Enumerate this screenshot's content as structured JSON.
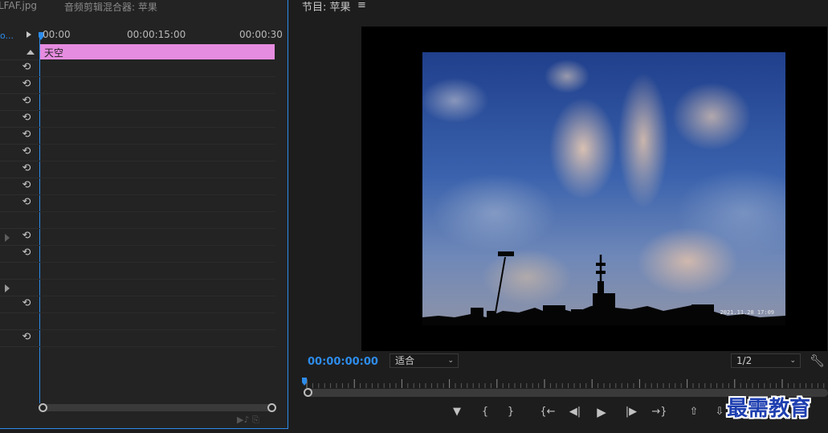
{
  "left_panel": {
    "tab_file": "LFAF.jpg",
    "tab_mixer": "音频剪辑混合器: 苹果",
    "header_label": "o...",
    "ruler": [
      "00:00",
      "00:00:15:00",
      "00:00:30"
    ],
    "clip_name": "天空",
    "reset_glyph": "⟲"
  },
  "program_monitor": {
    "title": "节目: 苹果",
    "menu_glyph": "≡",
    "timecode": "00:00:00:00",
    "fit_dropdown": "适合",
    "resolution_dropdown": "1/2",
    "video_timestamp": "2021.11.28 17:09",
    "chevron_glyph": "⌄",
    "transport": {
      "marker": "▼",
      "mark_in": "{",
      "mark_out": "}",
      "go_to_in": "{←",
      "step_back": "◀|",
      "play": "▶",
      "step_forward": "|▶",
      "go_to_out": "→}",
      "lift": "⇧",
      "extract": "⇩"
    }
  },
  "watermark": "最需教育",
  "colors": {
    "accent": "#2d8ceb",
    "clip": "#e68ce0"
  }
}
